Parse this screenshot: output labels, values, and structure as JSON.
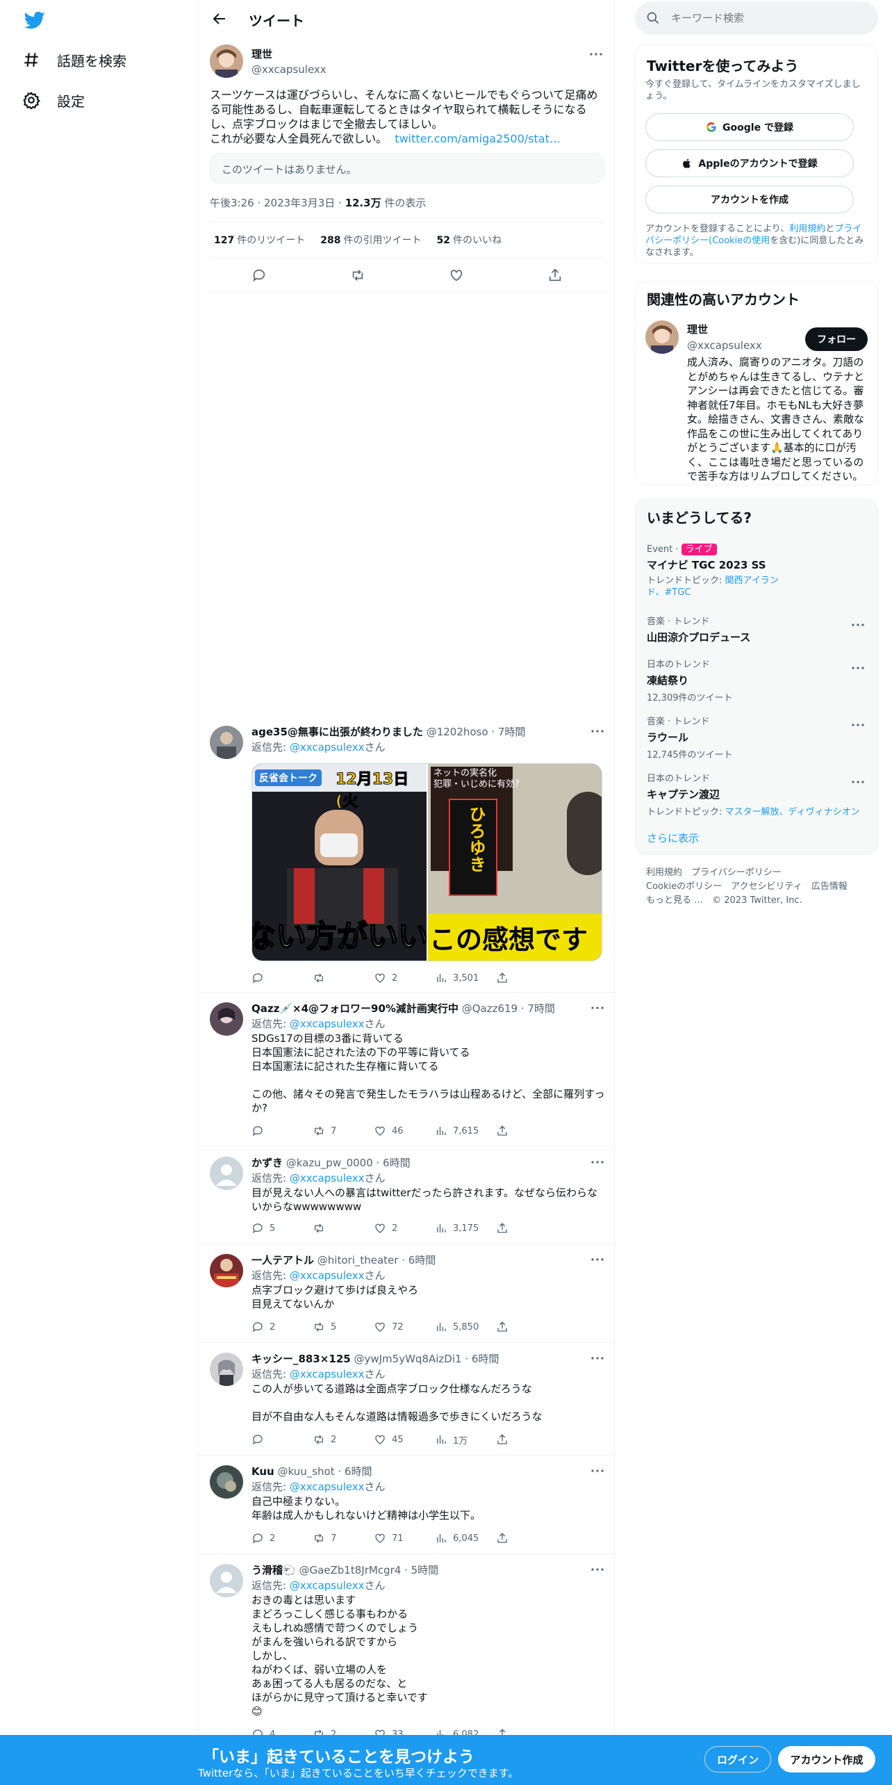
{
  "nav": {
    "explore_label": "話題を検索",
    "settings_label": "設定"
  },
  "header": {
    "title": "ツイート"
  },
  "tweet": {
    "name": "理世",
    "handle": "@xxcapsulexx",
    "text": "スーツケースは運びづらいし、そんなに高くないヒールでもぐらついて足痛める可能性あるし、自転車運転してるときはタイヤ取られて横転しそうになるし、点字ブロックはまじで全撤去してほしい。\nこれが必要な人全員死んで欲しい。",
    "link_text": "twitter.com/amiga2500/stat…",
    "quote_unavailable": "このツイートはありません。",
    "time": "午後3:26 · 2023年3月3日 · ",
    "views": "12.3万",
    "views_label": " 件の表示",
    "retweets": "127",
    "retweets_label": "件のリツイート",
    "quotes": "288",
    "quotes_label": "件の引用ツイート",
    "likes": "52",
    "likes_label": "件のいいね"
  },
  "reply_prefix": "返信先: ",
  "reply_to": "@xxcapsulexx",
  "reply_suffix": "さん",
  "replies": [
    {
      "name": "age35@無事に出張が終わりました",
      "handle": "@1202hoso · 7時間",
      "text": "",
      "media_left_tag": "反省会トーク",
      "media_left_date": "12月13日(火",
      "media_left_caption": "ない方がいい",
      "media_right_top": "ネットの実名化\n犯罪・いじめに有効?",
      "media_right_name": "ひろゆき",
      "media_right_caption": "この感想です",
      "reply_count": "",
      "rt_count": "",
      "like_count": "2",
      "view_count": "3,501"
    },
    {
      "name": "Qazz💉×4@フォロワー90%減計画実行中",
      "handle": "@Qazz619 · 7時間",
      "text": "SDGs17の目標の3番に背いてる\n日本国憲法に記された法の下の平等に背いてる\n日本国憲法に記された生存権に背いてる\n\nこの他、諸々その発言で発生したモラハラは山程あるけど、全部に羅列すっか?",
      "reply_count": "",
      "rt_count": "7",
      "like_count": "46",
      "view_count": "7,615"
    },
    {
      "name": "かずき",
      "handle": "@kazu_pw_0000 · 6時間",
      "text": "目が見えない人への暴言はtwitterだったら許されます。なぜなら伝わらないからなwwwwwwww",
      "reply_count": "5",
      "rt_count": "",
      "like_count": "2",
      "view_count": "3,175"
    },
    {
      "name": "一人テアトル",
      "handle": "@hitori_theater · 6時間",
      "text": "点字ブロック避けて歩けば良えやろ\n目見えてないんか",
      "reply_count": "2",
      "rt_count": "5",
      "like_count": "72",
      "view_count": "5,850"
    },
    {
      "name": "キッシー_883×125",
      "handle": "@ywJm5yWq8AizDi1 · 6時間",
      "text": "この人が歩いてる道路は全面点字ブロック仕様なんだろうな\n\n目が不自由な人もそんな道路は情報過多で歩きにくいだろうな",
      "reply_count": "",
      "rt_count": "2",
      "like_count": "45",
      "view_count": "1万"
    },
    {
      "name": "Kuu",
      "handle": "@kuu_shot · 6時間",
      "text": "自己中極まりない。\n年齢は成人かもしれないけど精神は小学生以下。",
      "reply_count": "2",
      "rt_count": "7",
      "like_count": "71",
      "view_count": "6,045"
    },
    {
      "name": "う滑稽🐑",
      "handle": "@GaeZb1t8JrMcgr4 · 5時間",
      "text": "おきの毒とは思います\nまどろっこしく感じる事もわかる\nえもしれぬ感情で苛つくのでしょう\nがまんを強いられる訳ですから\nしかし、\nねがわくば、弱い立場の人を\nあぁ困ってる人も居るのだな、と\nほがらかに見守って頂けると幸いです\n😊",
      "reply_count": "4",
      "rt_count": "2",
      "like_count": "33",
      "view_count": "6,082"
    }
  ],
  "side": {
    "search_placeholder": "キーワード検索",
    "signup_title": "Twitterを使ってみよう",
    "signup_sub": "今すぐ登録して、タイムラインをカスタマイズしましょう。",
    "google_btn": "Google で登録",
    "apple_btn": "Appleのアカウントで登録",
    "create_btn": "アカウントを作成",
    "terms_pre": "アカウントを登録することにより、",
    "terms_link1": "利用規約",
    "terms_mid": "と",
    "terms_link2": "プライバシーポリシー(Cookieの使用",
    "terms_post": "を含む)に同意したとみなされます。",
    "related_title": "関連性の高いアカウント",
    "related_name": "理世",
    "related_handle": "@xxcapsulexx",
    "follow_btn": "フォロー",
    "related_bio": "成人済み、腐寄りのアニオタ。刀語のとがめちゃんは生きてるし、ウテナとアンシーは再会できたと信じてる。審神者就任7年目。ホモもNLも大好き夢女。絵描きさん、文書きさん、素敵な作品をこの世に生み出してくれてありがとうございます🙏基本的に口が汚く、ここは毒吐き場だと思っているので苦手な方はリムブロしてください。",
    "trends_title": "いまどうしてる?",
    "trends": [
      {
        "cat": "Event · ",
        "badge": "ライブ",
        "name": "マイナビ TGC 2023 SS",
        "sub_pre": "トレンドトピック: ",
        "sub_link": "関西アイランド、#TGC"
      },
      {
        "cat": "音楽 · トレンド",
        "name": "山田涼介プロデュース",
        "sub": ""
      },
      {
        "cat": "日本のトレンド",
        "name": "凍結祭り",
        "sub": "12,309件のツイート"
      },
      {
        "cat": "音楽 · トレンド",
        "name": "ラウール",
        "sub": "12,745件のツイート"
      },
      {
        "cat": "日本のトレンド",
        "name": "キャプテン渡辺",
        "sub_pre": "トレンドトピック: ",
        "sub_link": "マスター解放、ディヴィナシオン"
      }
    ],
    "show_more": "さらに表示",
    "footer_line1": "利用規約　プライバシーポリシー",
    "footer_line2": "Cookieのポリシー　アクセシビリティ　広告情報",
    "footer_line3": "もっと見る …　© 2023 Twitter, Inc."
  },
  "bottom": {
    "title": "「いま」起きていることを見つけよう",
    "sub": "Twitterなら、「いま」起きていることをいち早くチェックできます。",
    "login": "ログイン",
    "signup": "アカウント作成"
  },
  "colors": {
    "accent": "#1d9bf0",
    "live": "#f91880"
  }
}
